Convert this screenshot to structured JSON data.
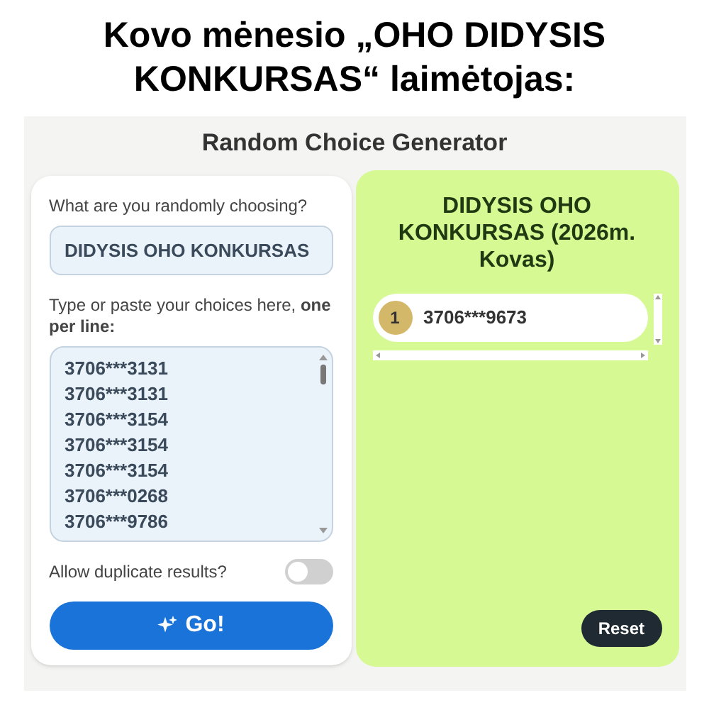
{
  "headline": "Kovo mėnesio „OHO DIDYSIS KONKURSAS“ laimėtojas:",
  "app": {
    "title": "Random Choice Generator",
    "topic": {
      "label": "What are you randomly choosing?",
      "value": "DIDYSIS OHO KONKURSAS"
    },
    "choices": {
      "label": "Type or paste your choices here, **one per line:**",
      "lines": [
        "3706***3131",
        "3706***3131",
        "3706***3154",
        "3706***3154",
        "3706***3154",
        "3706***0268",
        "3706***9786"
      ]
    },
    "allow_duplicates": {
      "label": "Allow duplicate results?",
      "on": false
    },
    "go_button": "Go!",
    "result": {
      "title": "DIDYSIS OHO KONKURSAS (2026m. Kovas)",
      "winners": [
        {
          "rank": "1",
          "value": "3706***9673"
        }
      ]
    },
    "reset_button": "Reset"
  }
}
